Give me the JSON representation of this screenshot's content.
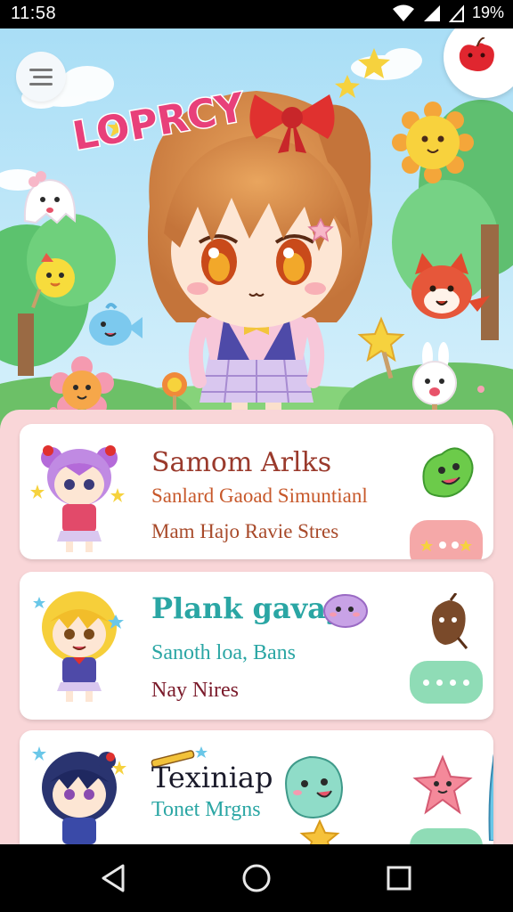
{
  "status_bar": {
    "time": "11:58",
    "battery": "19%"
  },
  "hero": {
    "logo_text": "LOPRCY"
  },
  "cards": [
    {
      "title": "Samom Arlks",
      "subtitle": "Sanlard Gaoad Simuntianl",
      "detail": "Mam Hajo Ravie Stres"
    },
    {
      "title": "Plank gavay",
      "subtitle": "Sanoth loa, Bans",
      "detail": "Nay Nires"
    },
    {
      "title": "Texiniap",
      "subtitle": "Tonet Mrgns",
      "detail": ""
    }
  ],
  "colors": {
    "sky": "#bfe6f8",
    "sheet_pink": "#f9d6d8",
    "title_red": "#9a3a2c",
    "accent_green": "#8fdcb6",
    "accent_pink": "#f5a8a8",
    "teal_text": "#2aa6a4"
  },
  "icons": {
    "menu": "hamburger-menu-icon",
    "favorite": "red-apple-icon",
    "back": "back-triangle-icon",
    "home": "home-circle-icon",
    "recents": "recents-square-icon"
  }
}
